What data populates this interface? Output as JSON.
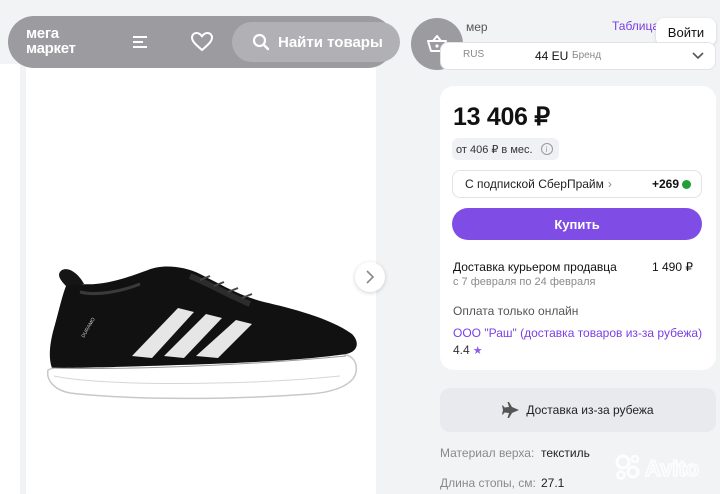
{
  "header": {
    "logo_line1": "мега",
    "logo_line2": "маркет",
    "search_label": "Найти товары"
  },
  "size": {
    "label": "мер",
    "table_link": "Таблица",
    "login_label": "Войти",
    "system": "RUS",
    "value": "44 EU",
    "brand_label": "Бренд"
  },
  "offer": {
    "price": "13 406 ₽",
    "installment": "от 406 ₽ в мес.",
    "subscription": "С подпиской СберПрайм",
    "bonus": "+269",
    "buy_label": "Купить",
    "delivery_title": "Доставка курьером продавца",
    "delivery_price": "1 490 ₽",
    "delivery_dates": "с 7 февраля по 24 февраля",
    "payment_note": "Оплата только онлайн",
    "seller": "ООО \"Раш\" (доставка товаров из-за рубежа)",
    "rating": "4.4"
  },
  "abroad": {
    "label": "Доставка из-за рубежа"
  },
  "specs": [
    {
      "label": "Материал верха:",
      "value": "текстиль"
    },
    {
      "label": "Длина стопы, см:",
      "value": "27.1"
    }
  ],
  "product": {
    "model_text": "DURAMO"
  },
  "watermark": "Avito",
  "colors": {
    "accent": "#7f4de6",
    "link": "#7b3fe4",
    "header_overlay": "#9b9ba0",
    "sber_green": "#21a038"
  }
}
